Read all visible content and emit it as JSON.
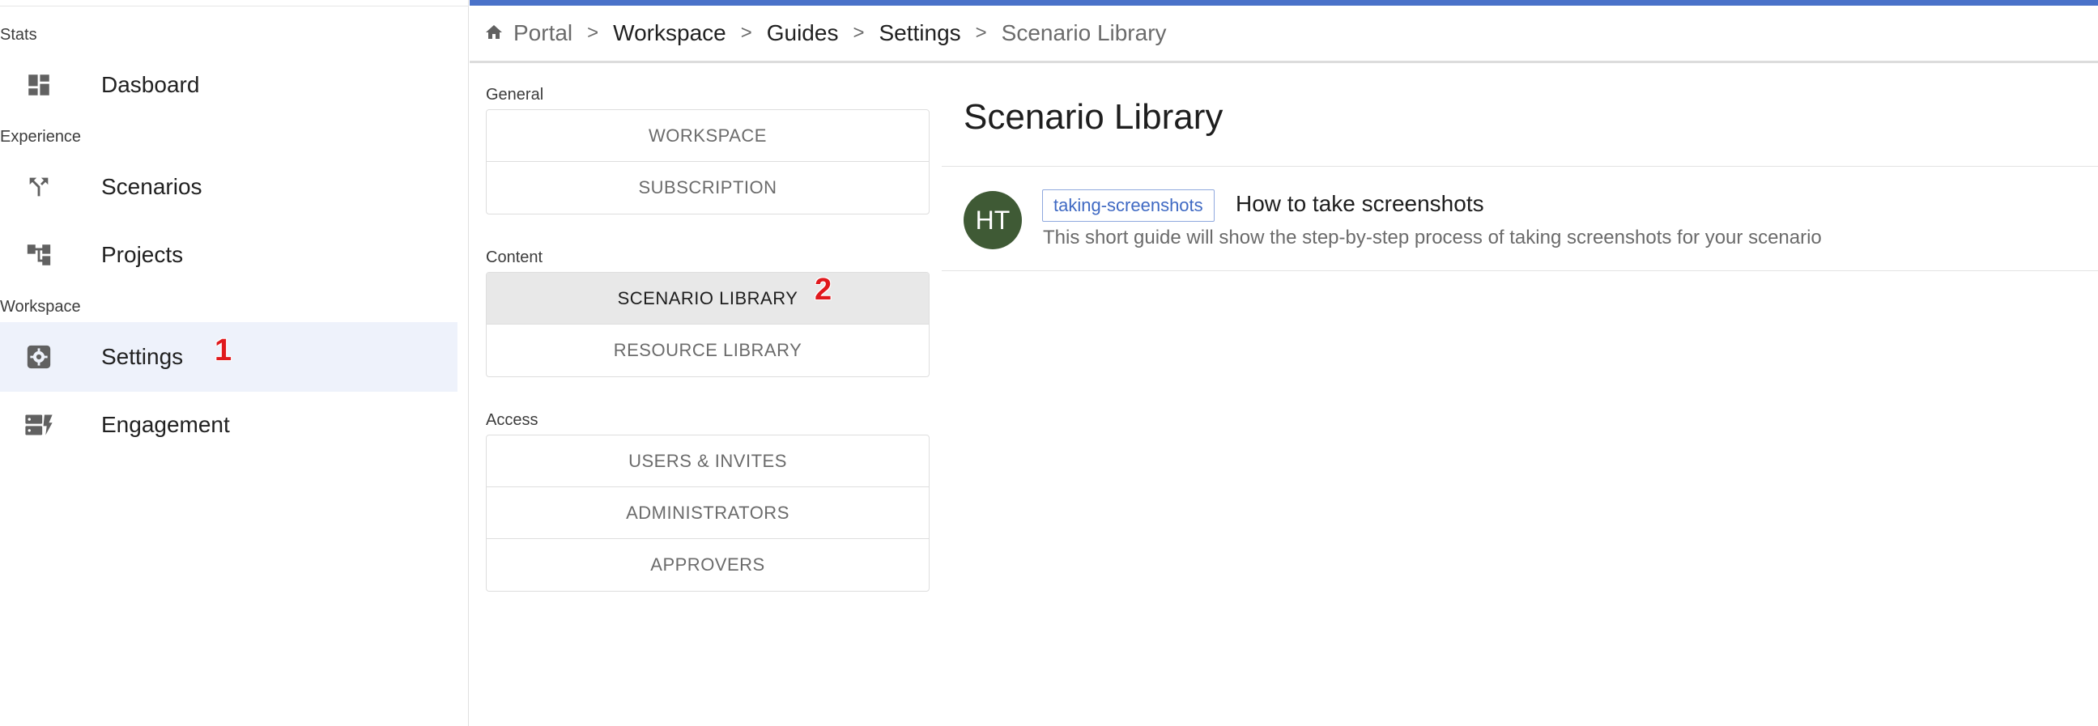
{
  "sidebar": {
    "sections": [
      {
        "label": "Stats"
      },
      {
        "label": "Experience"
      },
      {
        "label": "Workspace"
      }
    ],
    "items": [
      {
        "label": "Dasboard",
        "icon": "dashboard-icon"
      },
      {
        "label": "Scenarios",
        "icon": "fork-icon"
      },
      {
        "label": "Projects",
        "icon": "hierarchy-icon"
      },
      {
        "label": "Settings",
        "icon": "gear-icon",
        "active": true
      },
      {
        "label": "Engagement",
        "icon": "engagement-icon"
      }
    ],
    "marker": "1"
  },
  "breadcrumb": {
    "items": [
      "Portal",
      "Workspace",
      "Guides",
      "Settings",
      "Scenario Library"
    ],
    "separator": ">"
  },
  "settings_nav": {
    "groups": [
      {
        "label": "General",
        "buttons": [
          "WORKSPACE",
          "SUBSCRIPTION"
        ]
      },
      {
        "label": "Content",
        "buttons": [
          "SCENARIO LIBRARY",
          "RESOURCE LIBRARY"
        ],
        "selected": "SCENARIO LIBRARY"
      },
      {
        "label": "Access",
        "buttons": [
          "USERS & INVITES",
          "ADMINISTRATORS",
          "APPROVERS"
        ]
      }
    ],
    "marker": "2"
  },
  "main": {
    "title": "Scenario Library",
    "items": [
      {
        "avatar": "HT",
        "tag": "taking-screenshots",
        "title": "How to take screenshots",
        "description": "This short guide will show the step-by-step process of taking screenshots for your scenario"
      }
    ]
  },
  "colors": {
    "accent": "#4a72c9",
    "active_bg": "#eef2fb",
    "selected_btn_bg": "#e8e8e8",
    "avatar_bg": "#3f5a35",
    "marker": "#e0191d",
    "tag_text": "#3f69c3"
  }
}
